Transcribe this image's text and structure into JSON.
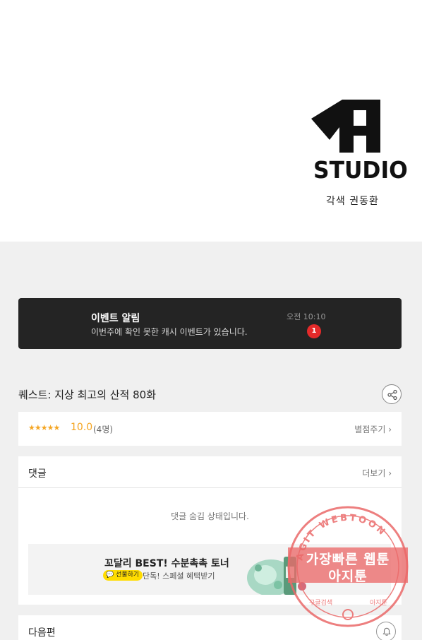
{
  "hero": {
    "logo_text": "STUDIO",
    "credit": "각색 권동환"
  },
  "event": {
    "title": "이벤트 알림",
    "description": "이번주에 확인 못한 캐시 이벤트가 있습니다.",
    "time": "오전 10:10",
    "badge_count": "1"
  },
  "episode": {
    "title": "퀘스트: 지상 최고의 산적 80화"
  },
  "rating": {
    "stars": "★★★★★",
    "score": "10.0",
    "count": "(4명)",
    "rate_link": "별점주기 ›"
  },
  "comments": {
    "title": "댓글",
    "more": "더보기 ›",
    "hidden_notice": "댓글 숨김 상태입니다."
  },
  "ad": {
    "title": "꼬달리 BEST! 수분촉촉 토너",
    "tag": "💬 선물하기",
    "subtitle": "단독! 스페셜 혜택받기"
  },
  "next": {
    "title": "다음편"
  },
  "watermark": {
    "ring_text": "AGIT WEBTOON",
    "line1": "가장빠른 웹툰",
    "line2": "아지툰",
    "bottom_left": "구글검색",
    "bottom_right": "아지툰"
  },
  "colors": {
    "accent_star": "#f5a623",
    "event_bg": "#242424",
    "badge": "#e52a2a",
    "watermark": "#ea6969"
  }
}
